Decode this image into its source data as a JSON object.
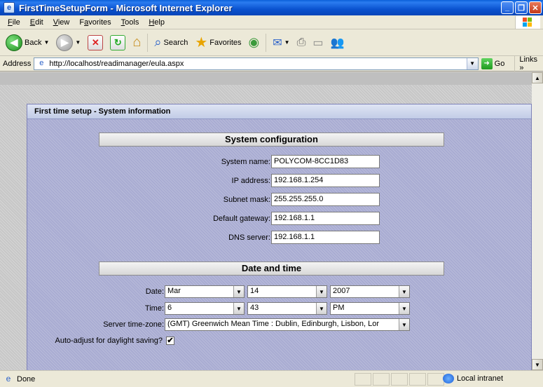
{
  "window": {
    "title": "FirstTimeSetupForm - Microsoft Internet Explorer"
  },
  "menu": {
    "items": [
      {
        "label": "File",
        "accel": "F",
        "rest": "ile"
      },
      {
        "label": "Edit",
        "accel": "E",
        "rest": "dit"
      },
      {
        "label": "View",
        "accel": "V",
        "rest": "iew"
      },
      {
        "label": "Favorites",
        "accel": "a",
        "pre": "F",
        "rest": "vorites"
      },
      {
        "label": "Tools",
        "accel": "T",
        "rest": "ools"
      },
      {
        "label": "Help",
        "accel": "H",
        "rest": "elp"
      }
    ]
  },
  "toolbar": {
    "back_label": "Back",
    "search_label": "Search",
    "favorites_label": "Favorites"
  },
  "address": {
    "label": "Address",
    "url": "http://localhost/readimanager/eula.aspx",
    "go_label": "Go",
    "links_label": "Links"
  },
  "panel": {
    "title": "First time setup - System information"
  },
  "system_config": {
    "heading": "System configuration",
    "fields": {
      "system_name": {
        "label": "System name:",
        "value": "POLYCOM-8CC1D83"
      },
      "ip_address": {
        "label": "IP address:",
        "value": "192.168.1.254"
      },
      "subnet_mask": {
        "label": "Subnet mask:",
        "value": "255.255.255.0"
      },
      "default_gateway": {
        "label": "Default gateway:",
        "value": "192.168.1.1"
      },
      "dns_server": {
        "label": "DNS server:",
        "value": "192.168.1.1"
      }
    }
  },
  "date_time": {
    "heading": "Date and time",
    "date_label": "Date:",
    "date_month": "Mar",
    "date_day": "14",
    "date_year": "2007",
    "time_label": "Time:",
    "time_hour": "6",
    "time_minute": "43",
    "time_ampm": "PM",
    "timezone_label": "Server time-zone:",
    "timezone_value": "(GMT) Greenwich Mean Time : Dublin, Edinburgh, Lisbon, Lor",
    "dst_label": "Auto-adjust for daylight saving?",
    "dst_checked": true
  },
  "status": {
    "text": "Done",
    "zone": "Local intranet"
  }
}
